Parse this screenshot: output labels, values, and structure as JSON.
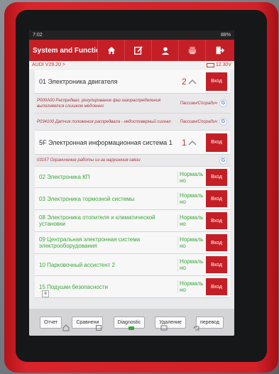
{
  "status": {
    "time": "7:02",
    "battery": "88%"
  },
  "header": {
    "title": "System and Function"
  },
  "info": {
    "vehicle": "AUDI V29.20 >",
    "voltage": "12.30V"
  },
  "systems": [
    {
      "name": "01 Электроника двигателя",
      "count": "2",
      "enter": "Вход",
      "dtcs": [
        {
          "desc": "P000A00 Распредвал, регулирование фаз газораспределения выполняется слишком медленно",
          "status": "Пассивн/Спорадич"
        },
        {
          "desc": "P034100 Датчик положения распредвала - недостоверный сигнал",
          "status": "Пассивн/Спорадич"
        }
      ]
    },
    {
      "name": "5F Электронная информационная система 1",
      "count": "1",
      "enter": "Вход",
      "dtcs": [
        {
          "desc": "03157 Ограничение работы из-за нарушения связи",
          "status": ""
        }
      ]
    }
  ],
  "normal_systems": [
    {
      "name": "02 Электроника КП",
      "status": "Нормаль но",
      "enter": "Вход"
    },
    {
      "name": "03 Электроника тормозной системы",
      "status": "Нормаль но",
      "enter": "Вход"
    },
    {
      "name": "08 Электроника отопителя и климатической установки",
      "status": "Нормаль но",
      "enter": "Вход"
    },
    {
      "name": "09 Центральная электронная система электрооборудования",
      "status": "Нормаль но",
      "enter": "Вход"
    },
    {
      "name": "10 Парковочный ассистент 2",
      "status": "Нормаль но",
      "enter": "Вход"
    },
    {
      "name": "15 Подушки безопасности",
      "status": "Нормаль но",
      "enter": "Вход"
    }
  ],
  "toolbar": {
    "report": "Отчет",
    "compare": "Сравнени",
    "diagnostic": "Diagnostic",
    "delete": "Удаление",
    "translate": "перевод"
  },
  "colors": {
    "brand": "#c41f26",
    "normal": "#3aa63a",
    "fault": "#c0392b"
  }
}
